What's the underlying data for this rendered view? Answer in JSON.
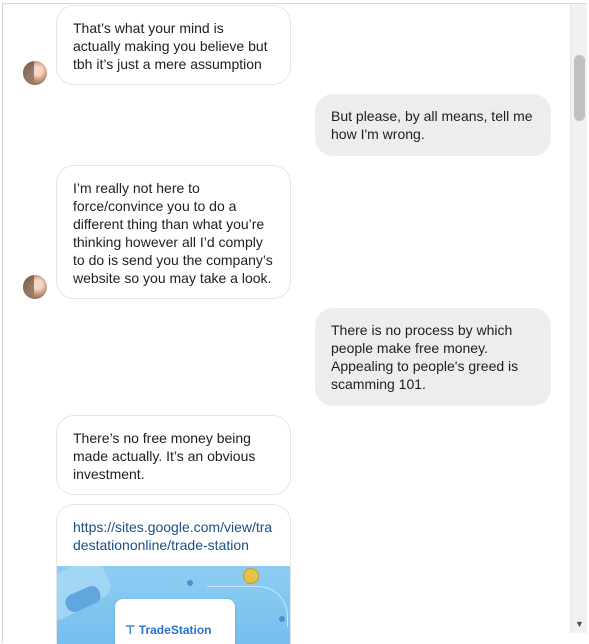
{
  "messages": [
    {
      "direction": "incoming",
      "text": "That’s what your mind is actually making you believe but tbh it’s just a mere assumption"
    },
    {
      "direction": "outgoing",
      "text": "But please, by all means, tell me how I'm wrong."
    },
    {
      "direction": "incoming",
      "text": "I’m really not here to force/convince you to do a different thing than what you’re thinking however all I’d comply to do is send you the company’s website so you may take a look."
    },
    {
      "direction": "outgoing",
      "text": "There is no process by which people make free money. Appealing to people's greed is scamming 101."
    },
    {
      "direction": "incoming",
      "text": "There’s no free money being made actually. It’s an obvious investment."
    }
  ],
  "link_message": {
    "url": "https://sites.google.com/view/tradestationonline/trade-station",
    "preview_logo_text": "TradeStation"
  },
  "icons": {
    "avatar": "avatar-icon",
    "scroll_down": "chevron-down-icon"
  },
  "colors": {
    "outgoing_bubble": "#ededed",
    "incoming_bubble_border": "#e4e6eb",
    "link": "#1d4e89"
  }
}
